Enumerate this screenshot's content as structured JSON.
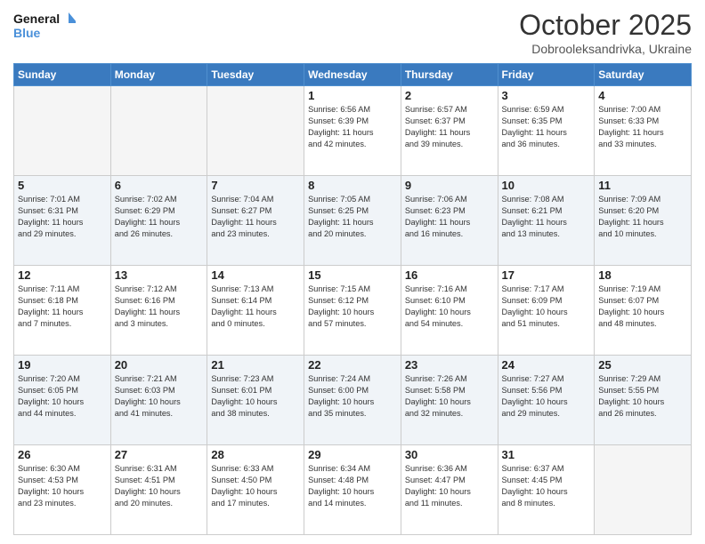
{
  "header": {
    "logo_line1": "General",
    "logo_line2": "Blue",
    "month": "October 2025",
    "location": "Dobrooleksandrivka, Ukraine"
  },
  "weekdays": [
    "Sunday",
    "Monday",
    "Tuesday",
    "Wednesday",
    "Thursday",
    "Friday",
    "Saturday"
  ],
  "weeks": [
    [
      {
        "day": "",
        "text": ""
      },
      {
        "day": "",
        "text": ""
      },
      {
        "day": "",
        "text": ""
      },
      {
        "day": "1",
        "text": "Sunrise: 6:56 AM\nSunset: 6:39 PM\nDaylight: 11 hours\nand 42 minutes."
      },
      {
        "day": "2",
        "text": "Sunrise: 6:57 AM\nSunset: 6:37 PM\nDaylight: 11 hours\nand 39 minutes."
      },
      {
        "day": "3",
        "text": "Sunrise: 6:59 AM\nSunset: 6:35 PM\nDaylight: 11 hours\nand 36 minutes."
      },
      {
        "day": "4",
        "text": "Sunrise: 7:00 AM\nSunset: 6:33 PM\nDaylight: 11 hours\nand 33 minutes."
      }
    ],
    [
      {
        "day": "5",
        "text": "Sunrise: 7:01 AM\nSunset: 6:31 PM\nDaylight: 11 hours\nand 29 minutes."
      },
      {
        "day": "6",
        "text": "Sunrise: 7:02 AM\nSunset: 6:29 PM\nDaylight: 11 hours\nand 26 minutes."
      },
      {
        "day": "7",
        "text": "Sunrise: 7:04 AM\nSunset: 6:27 PM\nDaylight: 11 hours\nand 23 minutes."
      },
      {
        "day": "8",
        "text": "Sunrise: 7:05 AM\nSunset: 6:25 PM\nDaylight: 11 hours\nand 20 minutes."
      },
      {
        "day": "9",
        "text": "Sunrise: 7:06 AM\nSunset: 6:23 PM\nDaylight: 11 hours\nand 16 minutes."
      },
      {
        "day": "10",
        "text": "Sunrise: 7:08 AM\nSunset: 6:21 PM\nDaylight: 11 hours\nand 13 minutes."
      },
      {
        "day": "11",
        "text": "Sunrise: 7:09 AM\nSunset: 6:20 PM\nDaylight: 11 hours\nand 10 minutes."
      }
    ],
    [
      {
        "day": "12",
        "text": "Sunrise: 7:11 AM\nSunset: 6:18 PM\nDaylight: 11 hours\nand 7 minutes."
      },
      {
        "day": "13",
        "text": "Sunrise: 7:12 AM\nSunset: 6:16 PM\nDaylight: 11 hours\nand 3 minutes."
      },
      {
        "day": "14",
        "text": "Sunrise: 7:13 AM\nSunset: 6:14 PM\nDaylight: 11 hours\nand 0 minutes."
      },
      {
        "day": "15",
        "text": "Sunrise: 7:15 AM\nSunset: 6:12 PM\nDaylight: 10 hours\nand 57 minutes."
      },
      {
        "day": "16",
        "text": "Sunrise: 7:16 AM\nSunset: 6:10 PM\nDaylight: 10 hours\nand 54 minutes."
      },
      {
        "day": "17",
        "text": "Sunrise: 7:17 AM\nSunset: 6:09 PM\nDaylight: 10 hours\nand 51 minutes."
      },
      {
        "day": "18",
        "text": "Sunrise: 7:19 AM\nSunset: 6:07 PM\nDaylight: 10 hours\nand 48 minutes."
      }
    ],
    [
      {
        "day": "19",
        "text": "Sunrise: 7:20 AM\nSunset: 6:05 PM\nDaylight: 10 hours\nand 44 minutes."
      },
      {
        "day": "20",
        "text": "Sunrise: 7:21 AM\nSunset: 6:03 PM\nDaylight: 10 hours\nand 41 minutes."
      },
      {
        "day": "21",
        "text": "Sunrise: 7:23 AM\nSunset: 6:01 PM\nDaylight: 10 hours\nand 38 minutes."
      },
      {
        "day": "22",
        "text": "Sunrise: 7:24 AM\nSunset: 6:00 PM\nDaylight: 10 hours\nand 35 minutes."
      },
      {
        "day": "23",
        "text": "Sunrise: 7:26 AM\nSunset: 5:58 PM\nDaylight: 10 hours\nand 32 minutes."
      },
      {
        "day": "24",
        "text": "Sunrise: 7:27 AM\nSunset: 5:56 PM\nDaylight: 10 hours\nand 29 minutes."
      },
      {
        "day": "25",
        "text": "Sunrise: 7:29 AM\nSunset: 5:55 PM\nDaylight: 10 hours\nand 26 minutes."
      }
    ],
    [
      {
        "day": "26",
        "text": "Sunrise: 6:30 AM\nSunset: 4:53 PM\nDaylight: 10 hours\nand 23 minutes."
      },
      {
        "day": "27",
        "text": "Sunrise: 6:31 AM\nSunset: 4:51 PM\nDaylight: 10 hours\nand 20 minutes."
      },
      {
        "day": "28",
        "text": "Sunrise: 6:33 AM\nSunset: 4:50 PM\nDaylight: 10 hours\nand 17 minutes."
      },
      {
        "day": "29",
        "text": "Sunrise: 6:34 AM\nSunset: 4:48 PM\nDaylight: 10 hours\nand 14 minutes."
      },
      {
        "day": "30",
        "text": "Sunrise: 6:36 AM\nSunset: 4:47 PM\nDaylight: 10 hours\nand 11 minutes."
      },
      {
        "day": "31",
        "text": "Sunrise: 6:37 AM\nSunset: 4:45 PM\nDaylight: 10 hours\nand 8 minutes."
      },
      {
        "day": "",
        "text": ""
      }
    ]
  ]
}
